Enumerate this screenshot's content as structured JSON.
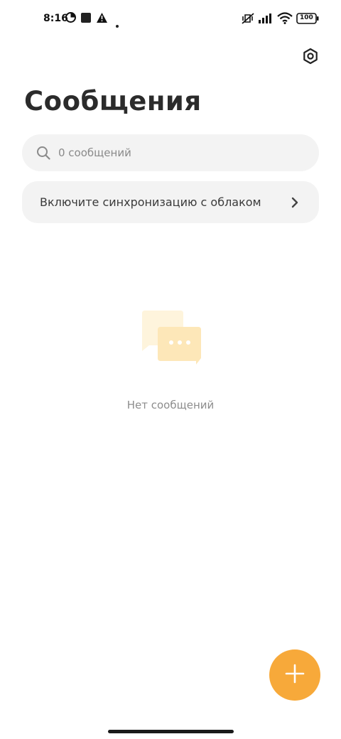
{
  "status_bar": {
    "time": "8:16",
    "battery": "100"
  },
  "header": {
    "title": "Сообщения"
  },
  "search": {
    "placeholder": "0 сообщений"
  },
  "sync_card": {
    "label": "Включите синхронизацию с облаком"
  },
  "empty_state": {
    "text": "Нет сообщений"
  },
  "colors": {
    "accent": "#f7a93a",
    "card_bg": "#f3f3f3",
    "illustration": "#fde7b8"
  },
  "icons": {
    "settings": "gear-icon",
    "search": "search-icon",
    "chevron": "chevron-right-icon",
    "fab": "plus-icon"
  }
}
